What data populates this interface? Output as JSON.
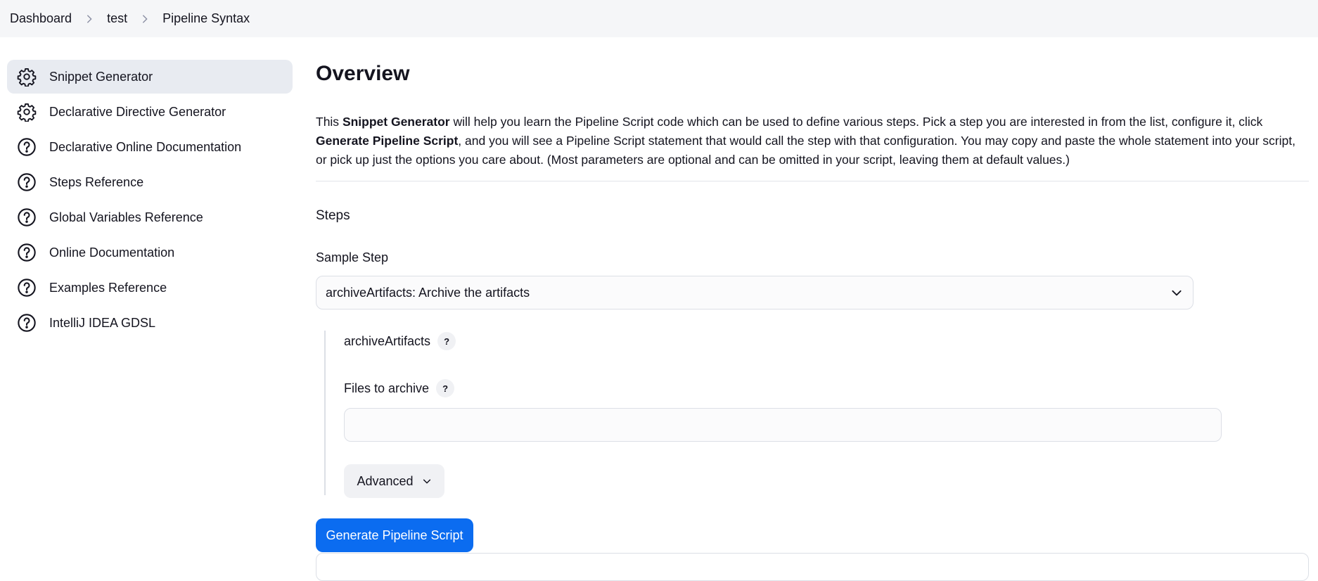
{
  "breadcrumb": {
    "items": [
      "Dashboard",
      "test",
      "Pipeline Syntax"
    ]
  },
  "sidebar": {
    "items": [
      {
        "label": "Snippet Generator",
        "icon": "gear-icon",
        "active": true
      },
      {
        "label": "Declarative Directive Generator",
        "icon": "gear-icon"
      },
      {
        "label": "Declarative Online Documentation",
        "icon": "help-circle-icon"
      },
      {
        "label": "Steps Reference",
        "icon": "help-circle-icon"
      },
      {
        "label": "Global Variables Reference",
        "icon": "help-circle-icon"
      },
      {
        "label": "Online Documentation",
        "icon": "help-circle-icon"
      },
      {
        "label": "Examples Reference",
        "icon": "help-circle-icon"
      },
      {
        "label": "IntelliJ IDEA GDSL",
        "icon": "help-circle-icon"
      }
    ]
  },
  "main": {
    "title": "Overview",
    "overview": {
      "t1": "This ",
      "b1": "Snippet Generator",
      "t2": " will help you learn the Pipeline Script code which can be used to define various steps. Pick a step you are interested in from the list, configure it, click ",
      "b2": "Generate Pipeline Script",
      "t3": ", and you will see a Pipeline Script statement that would call the step with that configuration. You may copy and paste the whole statement into your script, or pick up just the options you care about. (Most parameters are optional and can be omitted in your script, leaving them at default values.)"
    },
    "steps_title": "Steps",
    "sample_step_label": "Sample Step",
    "sample_step_value": "archiveArtifacts: Archive the artifacts",
    "step_name": "archiveArtifacts",
    "help_glyph": "?",
    "files_label": "Files to archive",
    "files_value": "",
    "advanced_label": "Advanced",
    "generate_label": "Generate Pipeline Script"
  },
  "colors": {
    "accent": "#0b6cf0",
    "breadcrumb_bg": "#f5f6f8",
    "active_item_bg": "#e8ebf1"
  }
}
